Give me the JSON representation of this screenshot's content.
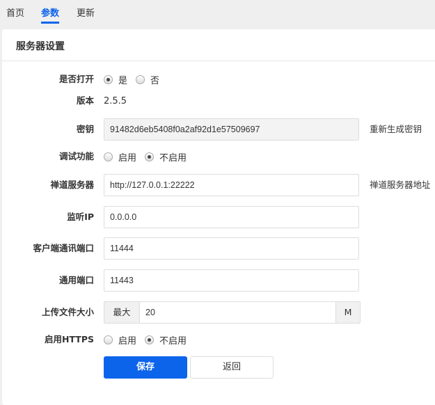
{
  "tabs": [
    {
      "label": "首页"
    },
    {
      "label": "参数",
      "active": true
    },
    {
      "label": "更新"
    }
  ],
  "card": {
    "title": "服务器设置"
  },
  "form": {
    "enabled": {
      "label": "是否打开",
      "options": [
        "是",
        "否"
      ],
      "selected": "是"
    },
    "version": {
      "label": "版本",
      "value": "2.5.5"
    },
    "secret": {
      "label": "密钥",
      "value": "91482d6eb5408f0a2af92d1e57509697",
      "action": "重新生成密钥"
    },
    "debug": {
      "label": "调试功能",
      "options": [
        "启用",
        "不启用"
      ],
      "selected": "不启用"
    },
    "zentao_server": {
      "label": "禅道服务器",
      "value": "http://127.0.0.1:22222",
      "help": "禅道服务器地址"
    },
    "listen_ip": {
      "label": "监听IP",
      "value": "0.0.0.0"
    },
    "client_port": {
      "label": "客户端通讯端口",
      "value": "11444"
    },
    "common_port": {
      "label": "通用端口",
      "value": "11443"
    },
    "upload_size": {
      "label": "上传文件大小",
      "prefix": "最大",
      "value": "20",
      "suffix": "M"
    },
    "https": {
      "label": "启用HTTPS",
      "options": [
        "启用",
        "不启用"
      ],
      "selected": "不启用"
    }
  },
  "buttons": {
    "save": "保存",
    "back": "返回"
  },
  "colors": {
    "accent": "#0c64eb",
    "background": "#efefef"
  }
}
